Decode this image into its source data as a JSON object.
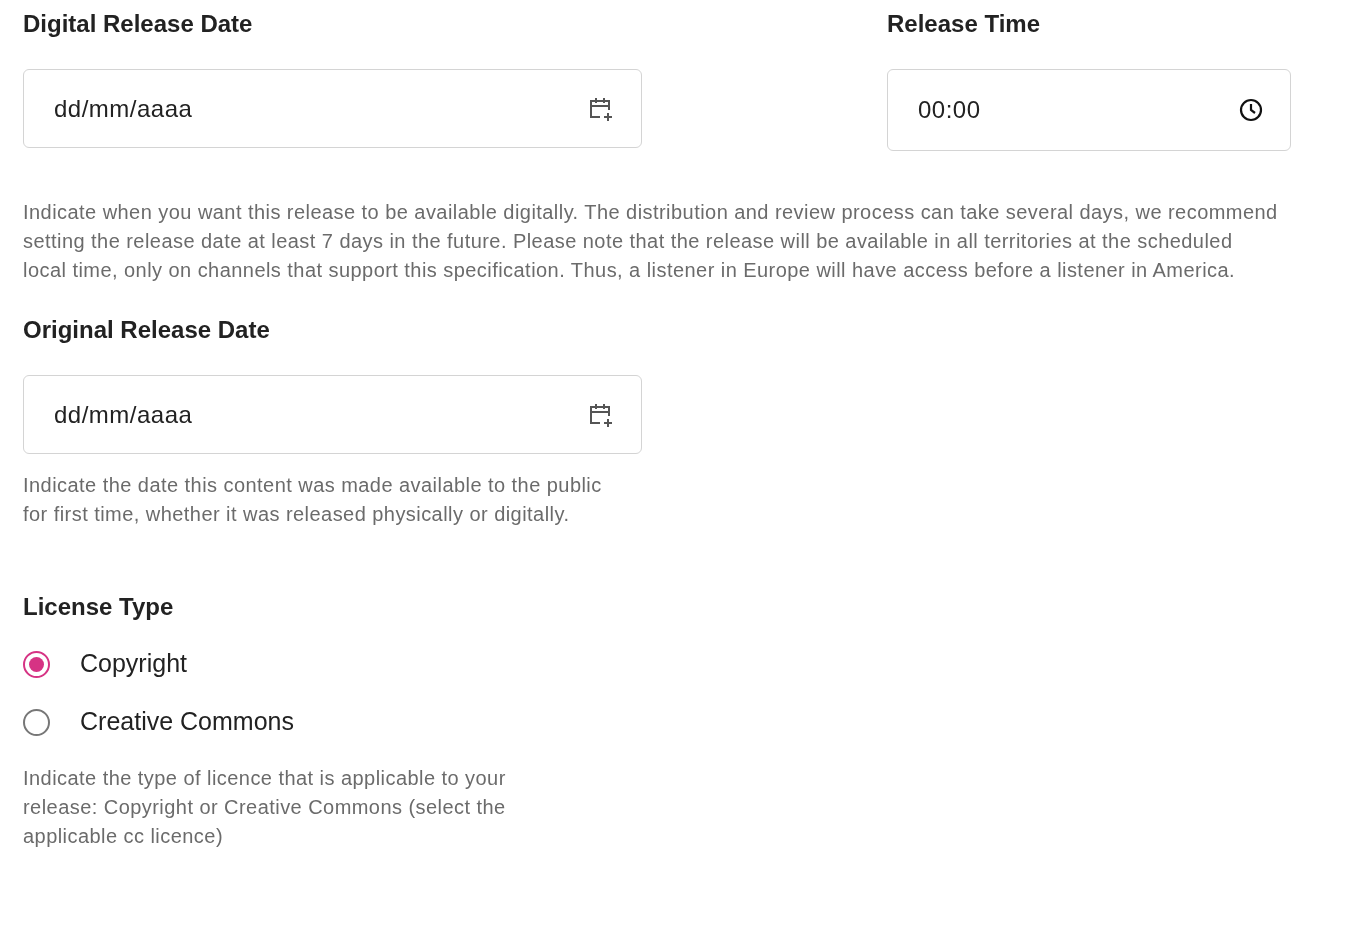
{
  "digital_release": {
    "label": "Digital Release Date",
    "value": "dd/mm/aaaa"
  },
  "release_time": {
    "label": "Release Time",
    "value": "00:00"
  },
  "digital_help": "Indicate when you want this release to be available digitally. The distribution and review process can take several days, we recommend setting the release date at least 7 days in the future. Please note that the release will be available in all territories at the scheduled local time, only on channels that support this specification. Thus, a listener in Europe will have access before a listener in America.",
  "original_release": {
    "label": "Original Release Date",
    "value": "dd/mm/aaaa"
  },
  "original_help": "Indicate the date this content was made available to the public for first time, whether it was released physically or digitally.",
  "license": {
    "label": "License Type",
    "options": [
      {
        "label": "Copyright",
        "selected": true
      },
      {
        "label": "Creative Commons",
        "selected": false
      }
    ],
    "help": "Indicate the type of licence that is applicable to your release: Copyright or Creative Commons (select the applicable cc licence)"
  }
}
